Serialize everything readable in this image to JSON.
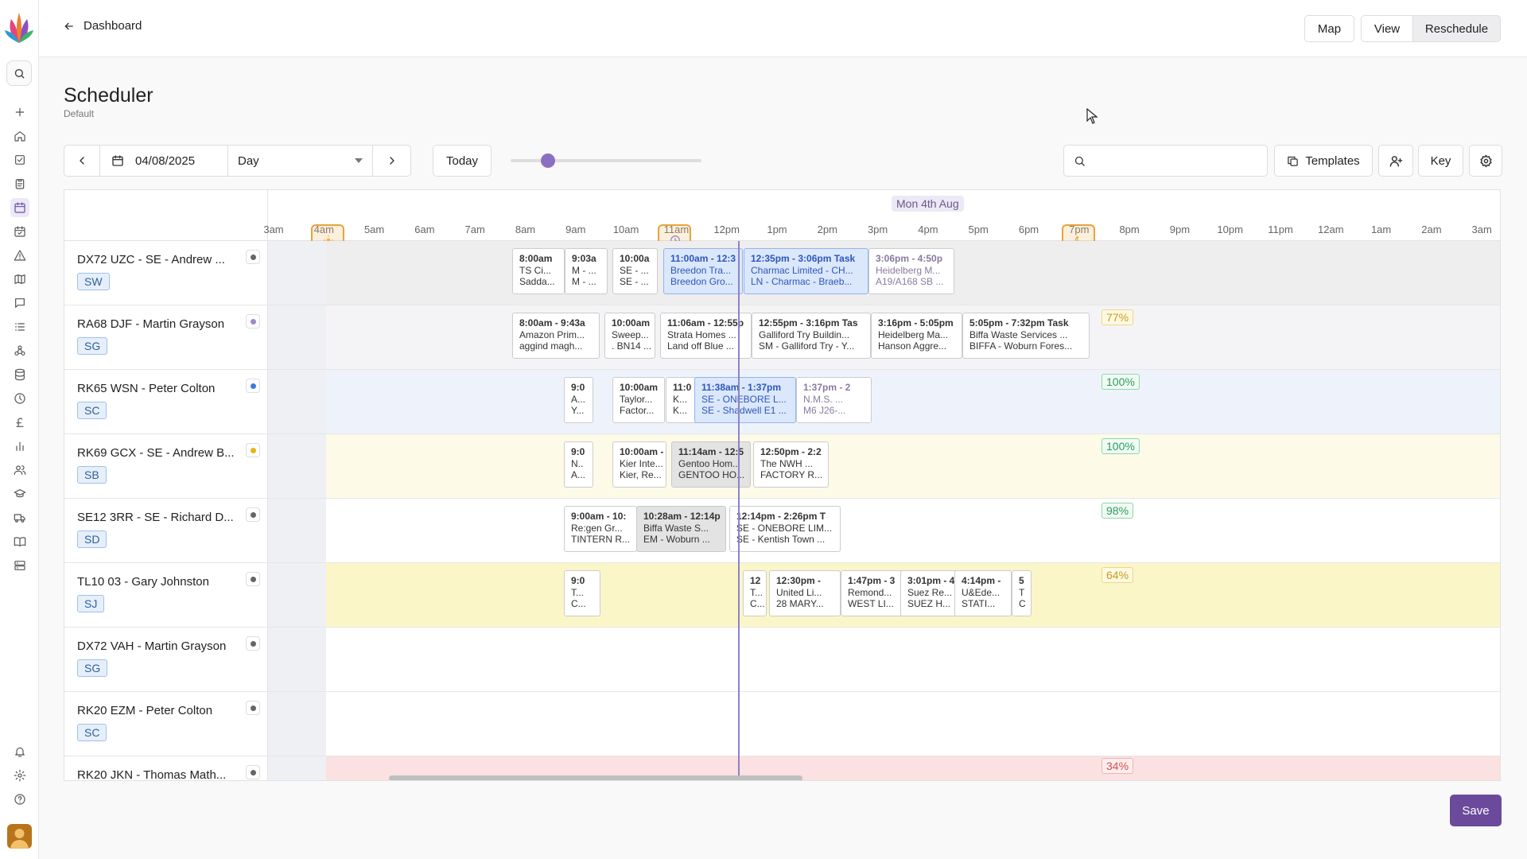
{
  "nav": {
    "back_label": "Dashboard"
  },
  "top_buttons": {
    "map": "Map",
    "view": "View",
    "reschedule": "Reschedule"
  },
  "page": {
    "title": "Scheduler",
    "subtitle": "Default"
  },
  "controls": {
    "date": "04/08/2025",
    "range": "Day",
    "today": "Today",
    "search_placeholder": "",
    "templates": "Templates",
    "key": "Key"
  },
  "timeline": {
    "date_label": "Mon 4th Aug",
    "hours": [
      "3am",
      "4am",
      "5am",
      "6am",
      "7am",
      "8am",
      "9am",
      "10am",
      "11am",
      "12pm",
      "1pm",
      "2pm",
      "3pm",
      "4pm",
      "5pm",
      "6pm",
      "7pm",
      "8pm",
      "9pm",
      "10pm",
      "11pm",
      "12am",
      "1am",
      "2am",
      "3am"
    ]
  },
  "rows": [
    {
      "name": "DX72 UZC - SE - Andrew ...",
      "badge": "SW",
      "dot": "#666666",
      "pct": "",
      "bg": "hatch-grey",
      "cards": [
        {
          "l1": "8:00am",
          "l2": "TS Ci...",
          "l3": "Sadda..."
        },
        {
          "l1": "9:03a",
          "l2": "M - ...",
          "l3": "M - ..."
        },
        {
          "l1": "10:00a",
          "l2": "SE - ...",
          "l3": "SE - ..."
        },
        {
          "l1": "11:00am - 12:3",
          "l2": "Breedon Tra...",
          "l3": "Breedon Gro...",
          "style": "blue"
        },
        {
          "l1": "12:35pm - 3:06pm  Task",
          "l2": "Charmac Limited - CH...",
          "l3": "LN - Charmac - Braeb...",
          "style": "blue"
        },
        {
          "l1": "3:06pm - 4:50p",
          "l2": "Heidelberg M...",
          "l3": "A19/A168 SB ...",
          "style": "muted"
        }
      ]
    },
    {
      "name": "RA68 DJF - Martin Grayson",
      "badge": "SG",
      "dot": "#9d8bc9",
      "pct": "77%",
      "pctClass": "warn",
      "bg": "hatch-light",
      "cards": [
        {
          "l1": "8:00am - 9:43a",
          "l2": "Amazon Prim...",
          "l3": "aggind magh..."
        },
        {
          "l1": "10:00am",
          "l2": "Sweep...",
          "l3": ". BN14 ..."
        },
        {
          "l1": "11:06am - 12:55p",
          "l2": "Strata Homes ...",
          "l3": "Land off Blue ..."
        },
        {
          "l1": "12:55pm - 3:16pm  Tas",
          "l2": "Galliford Try Buildin...",
          "l3": "SM - Galliford Try - Y..."
        },
        {
          "l1": "3:16pm - 5:05pm",
          "l2": "Heidelberg Ma...",
          "l3": "Hanson Aggre..."
        },
        {
          "l1": "5:05pm - 7:32pm  Task",
          "l2": "Biffa Waste Services ...",
          "l3": "BIFFA - Woburn Fores..."
        }
      ]
    },
    {
      "name": "RK65 WSN - Peter Colton",
      "badge": "SC",
      "dot": "#3b7ddd",
      "pct": "100%",
      "pctClass": "",
      "bg": "blue",
      "cards": [
        {
          "l1": "9:0",
          "l2": "A...",
          "l3": "Y..."
        },
        {
          "l1": "10:00am",
          "l2": "Taylor...",
          "l3": "Factor..."
        },
        {
          "l1": "11:0",
          "l2": "K...",
          "l3": "K..."
        },
        {
          "l1": "11:38am - 1:37pm",
          "l2": "SE - ONEBORE L...",
          "l3": "SE - Shadwell E1 ...",
          "style": "blue"
        },
        {
          "l1": "1:37pm - 2",
          "l2": "N.M.S. ...",
          "l3": "M6 J26-...",
          "style": "muted"
        }
      ]
    },
    {
      "name": "RK69 GCX - SE - Andrew B...",
      "badge": "SB",
      "dot": "#e6b417",
      "pct": "100%",
      "pctClass": "",
      "bg": "yellow",
      "cards": [
        {
          "l1": "9:0",
          "l2": "N..",
          "l3": "A..."
        },
        {
          "l1": "10:00am -",
          "l2": "Kier Inte...",
          "l3": "Kier, Re..."
        },
        {
          "l1": "11:14am - 12:5",
          "l2": "Gentoo Hom...",
          "l3": "GENTOO HO...",
          "style": "grey"
        },
        {
          "l1": "12:50pm - 2:2",
          "l2": "The NWH ...",
          "l3": "FACTORY R..."
        }
      ]
    },
    {
      "name": "SE12 3RR - SE - Richard D...",
      "badge": "SD",
      "dot": "#666666",
      "pct": "98%",
      "pctClass": "",
      "bg": "white",
      "cards": [
        {
          "l1": "9:00am - 10:",
          "l2": "Re:gen Gr...",
          "l3": "TINTERN R..."
        },
        {
          "l1": "10:28am - 12:14p",
          "l2": "Biffa Waste S...",
          "l3": "EM - Woburn ...",
          "style": "grey"
        },
        {
          "l1": "12:14pm - 2:26pm  T",
          "l2": "SE - ONEBORE LIM...",
          "l3": "SE - Kentish Town ..."
        }
      ]
    },
    {
      "name": "TL10 03 - Gary Johnston",
      "badge": "SJ",
      "dot": "#666666",
      "pct": "64%",
      "pctClass": "warn",
      "bg": "hatch-yellow",
      "cards": [
        {
          "l1": "9:0",
          "l2": "T...",
          "l3": "C..."
        },
        {
          "l1": "12",
          "l2": "T...",
          "l3": "C..."
        },
        {
          "l1": "12:30pm -",
          "l2": "United Li...",
          "l3": "28 MARY..."
        },
        {
          "l1": "1:47pm - 3",
          "l2": "Remond...",
          "l3": "WEST LI..."
        },
        {
          "l1": "3:01pm - 4",
          "l2": "Suez Re...",
          "l3": "SUEZ H..."
        },
        {
          "l1": "4:14pm -",
          "l2": "U&Ede...",
          "l3": "STATI..."
        },
        {
          "l1": "5",
          "l2": "T",
          "l3": "C"
        }
      ]
    },
    {
      "name": "DX72 VAH - Martin Grayson",
      "badge": "SG",
      "dot": "#666666",
      "pct": "",
      "bg": "white",
      "cards": []
    },
    {
      "name": "RK20 EZM - Peter Colton",
      "badge": "SC",
      "dot": "#666666",
      "pct": "",
      "bg": "white",
      "cards": []
    },
    {
      "name": "RK20 JKN - Thomas Math...",
      "badge": "",
      "dot": "#666666",
      "pct": "34%",
      "pctClass": "bad",
      "bg": "hatch-red",
      "cards": []
    }
  ],
  "save_label": "Save"
}
